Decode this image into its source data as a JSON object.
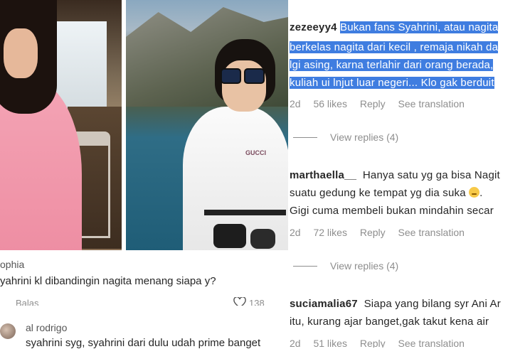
{
  "left": {
    "comment1": {
      "user": "ophia",
      "text": "yahrini kl dibandingin nagita menang siapa y?",
      "reply": "Balas",
      "likes": "138"
    },
    "comment2": {
      "user": "al rodrigo",
      "text": "syahrini syg, syahrini dari dulu udah prime banget"
    },
    "shirt_logo": "GUCCI"
  },
  "right": {
    "comments": [
      {
        "user": "zezeeyy4",
        "lines": [
          "Bukan fans Syahrini, atau nagita",
          "berkelas nagita dari kecil , remaja nikah da",
          "lgi asing, karna terlahir dari orang berada,",
          "kuliah ui lnjut luar negeri... Klo gak berduit"
        ],
        "time": "2d",
        "likes": "56 likes",
        "reply": "Reply",
        "translate": "See translation",
        "view_replies": "View replies (4)"
      },
      {
        "user": "marthaella__",
        "lines": [
          "Hanya satu yg ga bisa Nagit",
          "suatu gedung ke tempat yg dia suka",
          "Gigi cuma membeli bukan mindahin secar"
        ],
        "time": "2d",
        "likes": "72 likes",
        "reply": "Reply",
        "translate": "See translation",
        "view_replies": "View replies (4)"
      },
      {
        "user": "suciamalia67",
        "lines": [
          "Siapa yang bilang syr Ani Ar",
          "itu, kurang ajar banget,gak takut kena air"
        ],
        "time": "2d",
        "likes": "51 likes",
        "reply": "Reply",
        "translate": "See translation"
      }
    ]
  }
}
